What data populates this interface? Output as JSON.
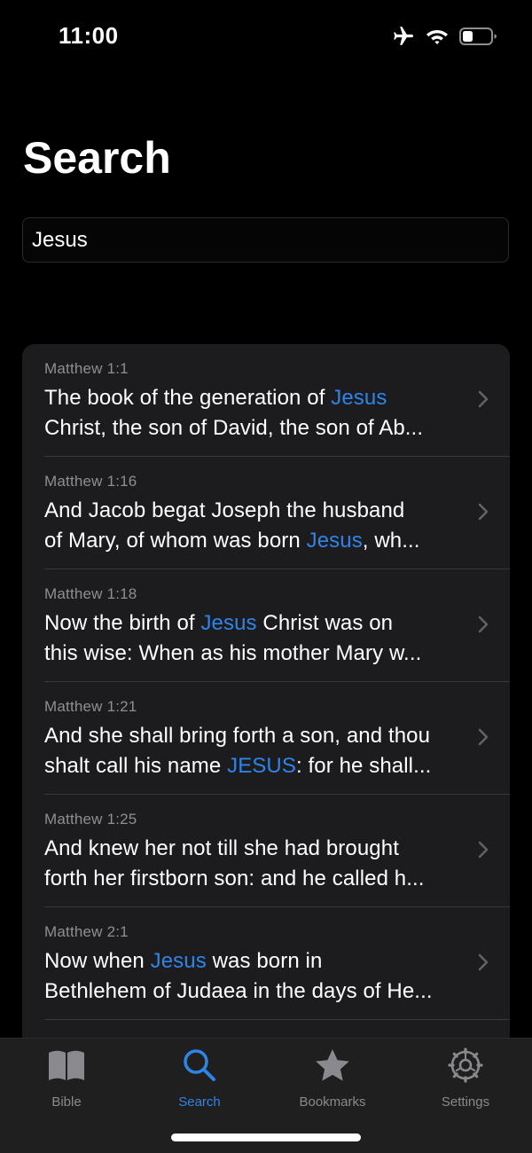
{
  "status_bar": {
    "time": "11:00",
    "icons": [
      "airplane-icon",
      "wifi-icon",
      "battery-icon"
    ]
  },
  "page": {
    "title": "Search"
  },
  "search": {
    "value": "Jesus"
  },
  "results": [
    {
      "reference": "Matthew 1:1",
      "line1": {
        "before": "The book of the generation of ",
        "highlight": "Jesus",
        "after": ""
      },
      "line2": {
        "before": "Christ, the son of David, the son of Ab...",
        "highlight": "",
        "after": ""
      }
    },
    {
      "reference": "Matthew 1:16",
      "line1": {
        "before": "And Jacob begat Joseph the husband",
        "highlight": "",
        "after": ""
      },
      "line2": {
        "before": "of Mary, of whom was born ",
        "highlight": "Jesus",
        "after": ", wh..."
      }
    },
    {
      "reference": "Matthew 1:18",
      "line1": {
        "before": "Now the birth of ",
        "highlight": "Jesus",
        "after": " Christ was on"
      },
      "line2": {
        "before": "this wise: When as his mother Mary w...",
        "highlight": "",
        "after": ""
      }
    },
    {
      "reference": "Matthew 1:21",
      "line1": {
        "before": "And she shall bring forth a son, and thou",
        "highlight": "",
        "after": ""
      },
      "line2": {
        "before": "shalt call his name ",
        "highlight": "JESUS",
        "after": ": for he shall..."
      }
    },
    {
      "reference": "Matthew 1:25",
      "line1": {
        "before": "And knew her not till she had brought",
        "highlight": "",
        "after": ""
      },
      "line2": {
        "before": "forth her firstborn son: and he called h...",
        "highlight": "",
        "after": ""
      }
    },
    {
      "reference": "Matthew 2:1",
      "line1": {
        "before": "Now when ",
        "highlight": "Jesus",
        "after": " was born in"
      },
      "line2": {
        "before": "Bethlehem of Judaea in the days of He...",
        "highlight": "",
        "after": ""
      }
    }
  ],
  "tab_bar": {
    "tabs": [
      {
        "label": "Bible",
        "icon": "book-icon",
        "active": false
      },
      {
        "label": "Search",
        "icon": "search-icon",
        "active": true
      },
      {
        "label": "Bookmarks",
        "icon": "star-icon",
        "active": false
      },
      {
        "label": "Settings",
        "icon": "gear-icon",
        "active": false
      }
    ]
  },
  "colors": {
    "accent": "#2f84e8",
    "background": "#000000",
    "card": "#1c1c1e",
    "secondary_text": "#8e8e93"
  }
}
